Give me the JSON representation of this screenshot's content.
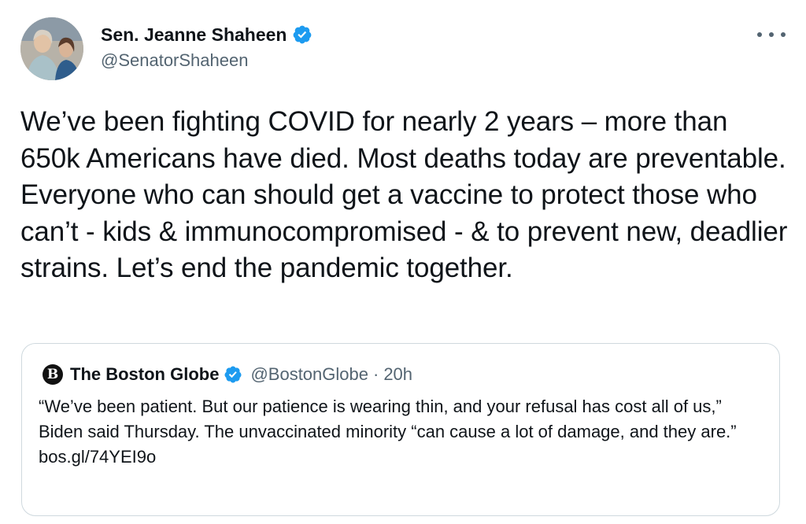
{
  "tweet": {
    "display_name": "Sen. Jeanne Shaheen",
    "handle": "@SenatorShaheen",
    "verified": true,
    "more_icon": "more-horizontal-icon",
    "text": "We’ve been fighting COVID for nearly 2 years – more than 650k Americans have died. Most deaths today are preventable. Everyone who can should get a vaccine to protect those who can’t - kids & immunocompromised - & to prevent new, deadlier strains. Let’s end the pandemic together."
  },
  "quoted": {
    "logo_glyph": "B",
    "display_name": "The Boston Globe",
    "verified": true,
    "handle": "@BostonGlobe",
    "separator": "·",
    "time": "20h",
    "text": "“We’ve been patient. But our patience is wearing thin, and your refusal has cost all of us,” Biden said Thursday. The unvaccinated minority “can cause a lot of damage, and they are.”",
    "link": "bos.gl/74YEI9o"
  },
  "colors": {
    "primary_text": "#0f1419",
    "secondary_text": "#536471",
    "verified_blue": "#1d9bf0",
    "border": "#cfd9de"
  }
}
